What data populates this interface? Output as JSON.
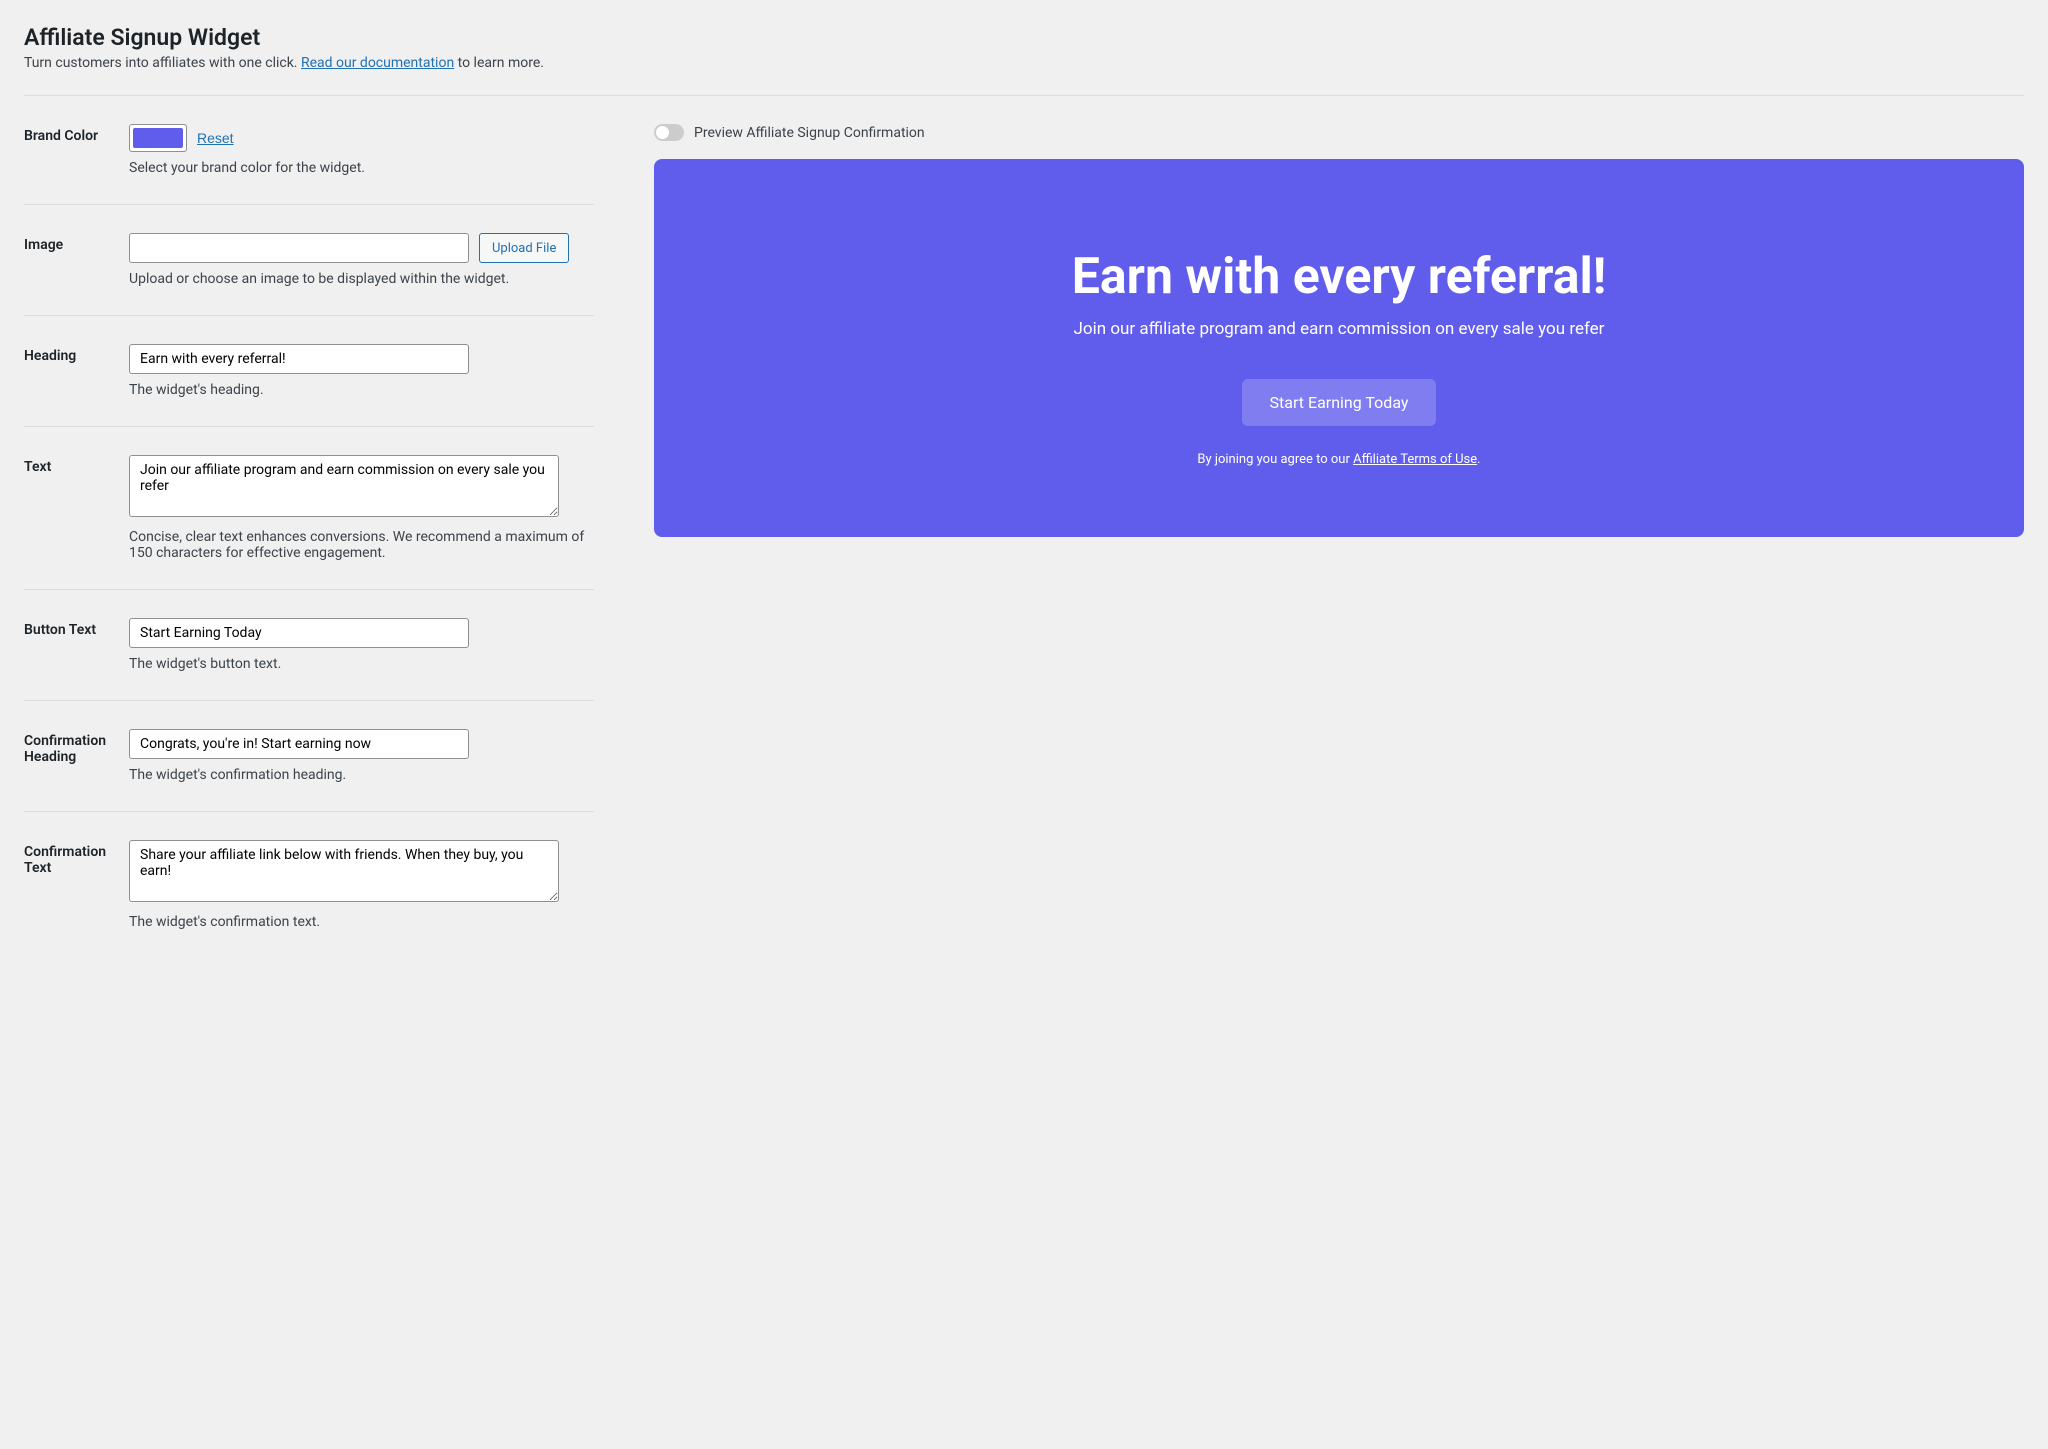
{
  "header": {
    "title": "Affiliate Signup Widget",
    "subtitle_prefix": "Turn customers into affiliates with one click. ",
    "subtitle_link": "Read our documentation",
    "subtitle_suffix": " to learn more."
  },
  "form": {
    "brand_color": {
      "label": "Brand Color",
      "reset": "Reset",
      "value": "#605dec",
      "description": "Select your brand color for the widget."
    },
    "image": {
      "label": "Image",
      "value": "",
      "upload_button": "Upload File",
      "description": "Upload or choose an image to be displayed within the widget."
    },
    "heading": {
      "label": "Heading",
      "value": "Earn with every referral!",
      "description": "The widget's heading."
    },
    "text": {
      "label": "Text",
      "value": "Join our affiliate program and earn commission on every sale you refer",
      "description": "Concise, clear text enhances conversions. We recommend a maximum of 150 characters for effective engagement."
    },
    "button_text": {
      "label": "Button Text",
      "value": "Start Earning Today",
      "description": "The widget's button text."
    },
    "confirmation_heading": {
      "label": "Confirmation Heading",
      "value": "Congrats, you're in! Start earning now",
      "description": "The widget's confirmation heading."
    },
    "confirmation_text": {
      "label": "Confirmation Text",
      "value": "Share your affiliate link below with friends. When they buy, you earn!",
      "description": "The widget's confirmation text."
    }
  },
  "preview": {
    "toggle_label": "Preview Affiliate Signup Confirmation",
    "terms_prefix": "By joining you agree to our ",
    "terms_link": "Affiliate Terms of Use",
    "terms_suffix": "."
  }
}
